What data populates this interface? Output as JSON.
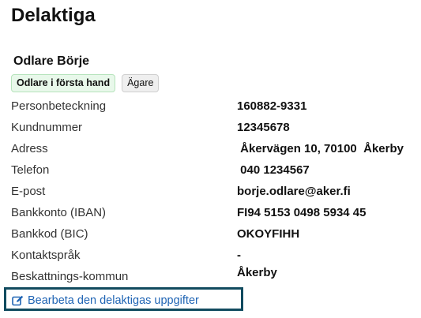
{
  "page": {
    "title": "Delaktiga"
  },
  "person": {
    "name": "Odlare Börje",
    "badges": [
      "Odlare i första hand",
      "Ägare"
    ]
  },
  "details": [
    {
      "label": "Personbeteckning",
      "value": "160882-9331"
    },
    {
      "label": "Kundnummer",
      "value": "12345678"
    },
    {
      "label": "Adress",
      "value": " Åkervägen 10, 70100  Åkerby"
    },
    {
      "label": "Telefon",
      "value": " 040 1234567"
    },
    {
      "label": "E-post",
      "value": "borje.odlare@aker.fi"
    },
    {
      "label": "Bankkonto (IBAN)",
      "value": "FI94 5153 0498 5934 45"
    },
    {
      "label": "Bankkod (BIC)",
      "value": "OKOYFIHH"
    },
    {
      "label": "Kontaktspråk",
      "value": "-"
    },
    {
      "label": "Beskattnings-kommun",
      "value": "Åkerby"
    }
  ],
  "actions": {
    "edit_label": "Bearbeta den delaktigas uppgifter",
    "edit_icon": "edit-icon"
  },
  "colors": {
    "link": "#1f64b4",
    "focus_border": "#114b5f",
    "badge_primary_bg": "#e8f8ea"
  }
}
